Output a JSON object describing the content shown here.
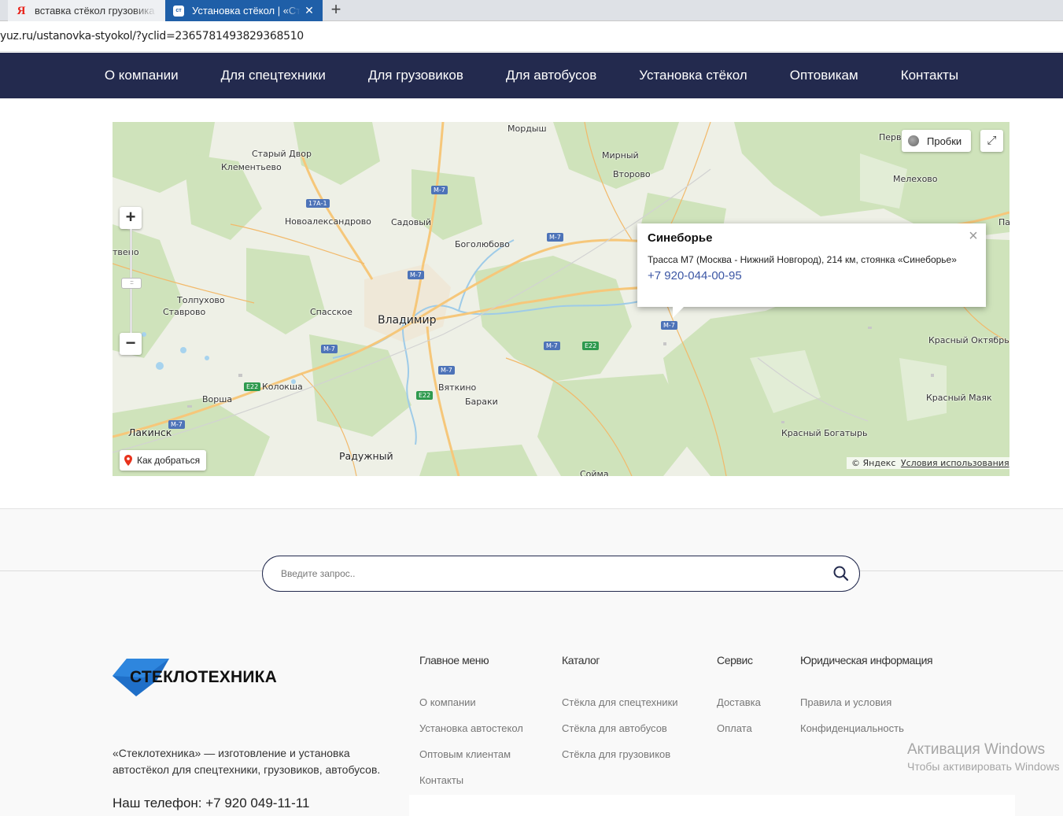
{
  "browser": {
    "tabs": [
      {
        "title": "вставка стёкол грузовика -",
        "favicon": "Я",
        "active": false
      },
      {
        "title": "Установка стёкол | «Стек",
        "favicon": "ст",
        "active": true
      }
    ],
    "tab_close": "✕",
    "new_tab": "+",
    "url": "yuz.ru/ustanovka-styokol/?yclid=2365781493829368510"
  },
  "nav": {
    "items": [
      "О компании",
      "Для спецтехники",
      "Для грузовиков",
      "Для автобусов",
      "Установка стёкол",
      "Оптовикам",
      "Контакты"
    ]
  },
  "map": {
    "places": [
      "Мордыш",
      "Мирный",
      "Второво",
      "Мелехово",
      "Старый Двор",
      "Клементьево",
      "Новоалександрово",
      "Садовый",
      "Боголюбово",
      "Толпухово",
      "Ставрово",
      "Спасское",
      "Владимир",
      "Колокша",
      "Ворша",
      "Лакинск",
      "Вяткино",
      "Бараки",
      "Радужный",
      "Сойма",
      "Красный Октябрь",
      "Красный Маяк",
      "Красный Богатырь",
      "Перв",
      "Па",
      "твено"
    ],
    "road_shields": [
      "17А-1",
      "М-7",
      "М-7",
      "М-7",
      "М-7",
      "М-7",
      "М-7",
      "М-7",
      "М-7",
      "Е22",
      "Е22",
      "Е22"
    ],
    "controls": {
      "zoom_in": "+",
      "zoom_out": "−",
      "traffic": "Пробки",
      "route": "Как добраться",
      "fullscreen": "⤢"
    },
    "copyright_prefix": "©",
    "copyright": "Яндекс",
    "terms": "Условия использования",
    "balloon": {
      "title": "Синеборье",
      "address": "Трасса М7 (Москва - Нижний Новгород), 214 км, стоянка «Синеборье»",
      "phone": "+7 920-044-00-95",
      "close": "×"
    }
  },
  "footer": {
    "search_placeholder": "Введите запрос..",
    "logo_text": "СТЕКЛОТЕХНИКА",
    "about": "«Стеклотехника» — изготовление и установка автостёкол для спецтехники, грузовиков, автобусов.",
    "phone": "Наш телефон: +7 920 049-11-11",
    "columns": [
      {
        "heading": "Главное меню",
        "links": [
          "О компании",
          "Установка автостекол",
          "Оптовым клиентам",
          "Контакты"
        ]
      },
      {
        "heading": "Каталог",
        "links": [
          "Стёкла для спецтехники",
          "Стёкла для автобусов",
          "Стёкла для грузовиков"
        ]
      },
      {
        "heading": "Сервис",
        "links": [
          "Доставка",
          "Оплата"
        ]
      },
      {
        "heading": "Юридическая информация",
        "links": [
          "Правила и условия",
          "Конфиденциальность"
        ]
      }
    ]
  },
  "watermark": {
    "line1": "Активация Windows",
    "line2": "Чтобы активировать Windows"
  },
  "colors": {
    "nav_bg": "#232a4e",
    "tab_active": "#1f5fa8",
    "logo_blue": "#1f6fc8",
    "phone_link": "#3c57a5"
  }
}
